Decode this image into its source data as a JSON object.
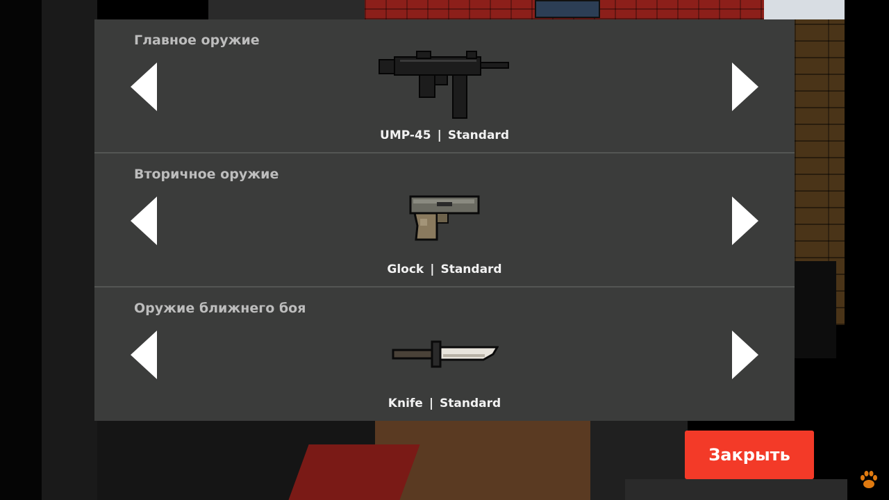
{
  "panel": {
    "sections": [
      {
        "title": "Главное оружие",
        "weapon": "UMP-45",
        "separator": "|",
        "skin": "Standard",
        "icon": "smg-icon"
      },
      {
        "title": "Вторичное оружие",
        "weapon": "Glock",
        "separator": "|",
        "skin": "Standard",
        "icon": "pistol-icon"
      },
      {
        "title": "Оружие ближнего боя",
        "weapon": "Knife",
        "separator": "|",
        "skin": "Standard",
        "icon": "knife-icon"
      }
    ]
  },
  "close_button": {
    "label": "Закрыть"
  },
  "colors": {
    "panel_bg": "#3b3c3b",
    "close_bg": "#f33a28",
    "label_text": "#f2f2f2",
    "title_text": "#bdbdbd"
  },
  "overlay_icon": "paw-icon"
}
